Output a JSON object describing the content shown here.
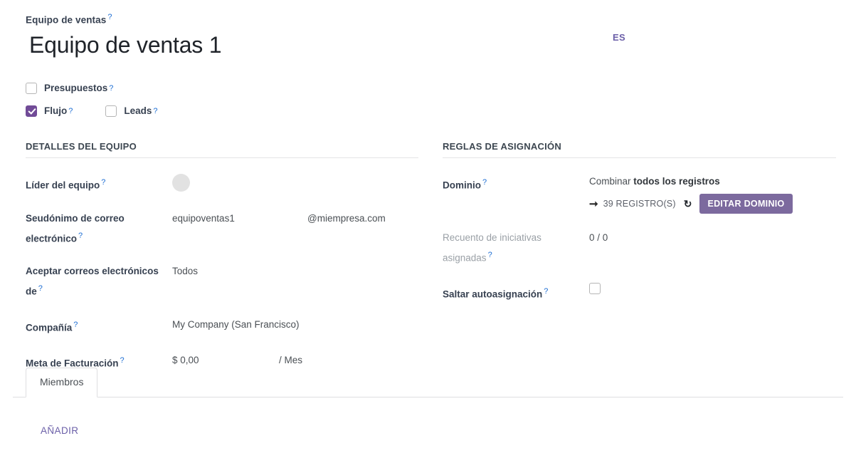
{
  "header": {
    "field_caption": "Equipo de ventas",
    "help_mark": "?",
    "record_title": "Equipo de ventas 1",
    "lang_badge": "ES"
  },
  "options": [
    {
      "label": "Presupuestos",
      "checked": false
    },
    {
      "label": "Flujo",
      "checked": true
    },
    {
      "label": "Leads",
      "checked": false
    }
  ],
  "team_details": {
    "group_title": "DETALLES DEL EQUIPO",
    "leader": {
      "label": "Líder del equipo",
      "avatar": "avatar-placeholder"
    },
    "alias": {
      "label": "Seudónimo de correo electrónico",
      "name": "equipoventas1",
      "domain": "@miempresa.com"
    },
    "accept_from": {
      "label": "Aceptar correos electrónicos de",
      "value": "Todos"
    },
    "company": {
      "label": "Compañía",
      "value": "My Company (San Francisco)"
    },
    "invoicing_target": {
      "label": "Meta de Facturación",
      "amount": "$ 0,00",
      "period": "/ Mes"
    }
  },
  "assignment_rules": {
    "group_title": "REGLAS DE ASIGNACIÓN",
    "domain": {
      "label": "Dominio",
      "match_prefix": "Combinar",
      "match_bold": "todos los registros",
      "arrow_icon": "arrow-right-icon",
      "record_count": "39 REGISTRO(S)",
      "refresh_icon": "refresh-icon",
      "edit_button": "EDITAR DOMINIO"
    },
    "assigned_leads_count": {
      "label": "Recuento de iniciativas asignadas",
      "value": "0 / 0"
    },
    "skip_auto_assign": {
      "label": "Saltar autoasignación",
      "checked": false
    }
  },
  "notebook": {
    "tabs": [
      {
        "label": "Miembros",
        "active": true
      }
    ],
    "add_link": "AÑADIR"
  },
  "colors": {
    "accent_purple": "#714b97",
    "button_violet": "#7c6a9e",
    "link_violet": "#6b5fa8",
    "help_blue": "#1f6fd4",
    "label_dark": "#374151",
    "value_gray": "#4a4f54",
    "muted_gray": "#9aa0a6",
    "border_gray": "#dfdfe1"
  }
}
